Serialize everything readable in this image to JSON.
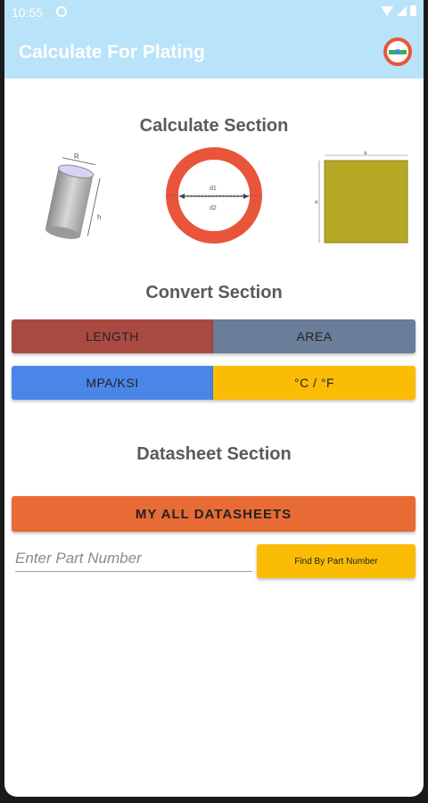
{
  "status_bar": {
    "time": "10:55"
  },
  "app_bar": {
    "title": "Calculate For Plating",
    "logo_icon": "app-logo-icon"
  },
  "calculate_section": {
    "title": "Calculate Section",
    "cylinder": {
      "label_r": "R",
      "label_h": "h"
    },
    "ring": {
      "label_d1": "d1",
      "label_d2": "d2",
      "color": "#e8553a"
    },
    "square": {
      "label_a": "a",
      "label_b": "a",
      "color": "#b5a825"
    }
  },
  "convert_section": {
    "title": "Convert Section",
    "buttons": [
      {
        "label": "LENGTH",
        "color": "#a94a42"
      },
      {
        "label": "AREA",
        "color": "#6a7d99"
      },
      {
        "label": "MPA/KSI",
        "color": "#4a86e8"
      },
      {
        "label": "°C / °F",
        "color": "#fbbc05"
      }
    ]
  },
  "datasheet_section": {
    "title": "Datasheet Section",
    "all_button": "MY ALL DATASHEETS",
    "part_input_placeholder": "Enter Part Number",
    "part_input_value": "",
    "find_button": "Find By Part Number"
  },
  "colors": {
    "appbar": "#b9e3f8",
    "accent_orange": "#e86b35",
    "accent_yellow": "#fbbc05"
  }
}
